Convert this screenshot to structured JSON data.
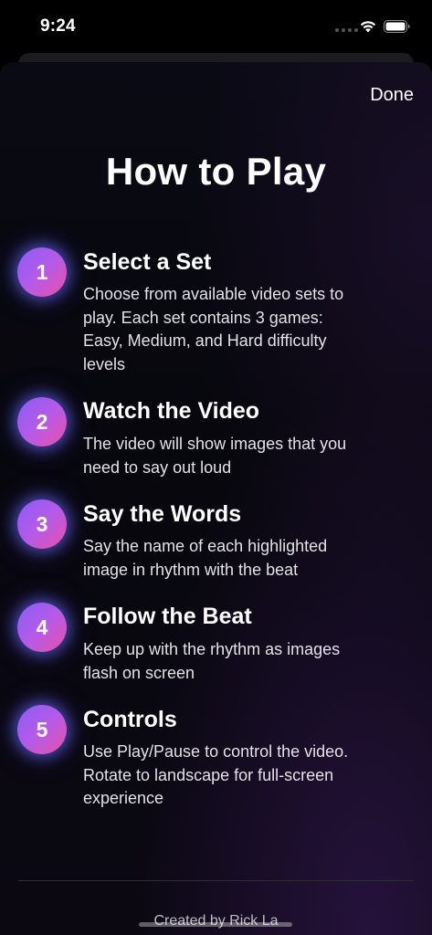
{
  "status_bar": {
    "time": "9:24"
  },
  "header": {
    "done_label": "Done",
    "title": "How to Play"
  },
  "steps": [
    {
      "number": "1",
      "title": "Select a Set",
      "lines": [
        "Choose from available video sets to",
        "play. Each set contains 3 games:",
        "Easy, Medium, and Hard difficulty",
        "levels"
      ]
    },
    {
      "number": "2",
      "title": "Watch the Video",
      "lines": [
        "The video will show images that you",
        "need to say out loud"
      ]
    },
    {
      "number": "3",
      "title": "Say the Words",
      "lines": [
        "Say the name of each highlighted",
        "image in rhythm with the beat"
      ]
    },
    {
      "number": "4",
      "title": "Follow the Beat",
      "lines": [
        "Keep up with the rhythm as images",
        "flash on screen"
      ]
    },
    {
      "number": "5",
      "title": "Controls",
      "lines": [
        "Use Play/Pause to control the video.",
        "Rotate to landscape for full-screen",
        "experience"
      ]
    }
  ],
  "footer": {
    "credit": "Created by Rick La"
  },
  "colors": {
    "badge_gradient_start": "#8a5cf6",
    "badge_gradient_end": "#ec4fa6",
    "badge_glow": "#5c6eff",
    "background": "#000000"
  }
}
